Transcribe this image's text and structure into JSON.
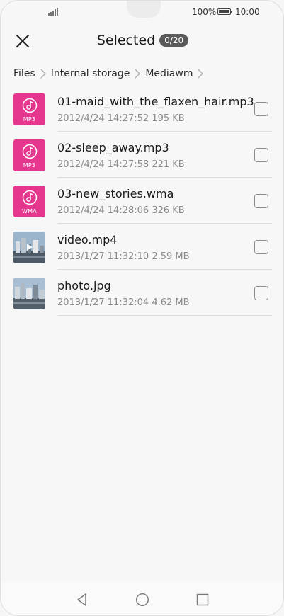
{
  "status_bar": {
    "battery_percent": "100%",
    "time": "10:00"
  },
  "header": {
    "title": "Selected",
    "count_badge": "0/20",
    "close_icon": "close-icon"
  },
  "breadcrumb": [
    "Files",
    "Internal storage",
    "Mediawm"
  ],
  "files": [
    {
      "name": "01-maid_with_the_flaxen_hair.mp3",
      "date": "2012/4/24 14:27:52",
      "size": "195 KB",
      "type": "music",
      "badge": "MP3",
      "checked": false
    },
    {
      "name": "02-sleep_away.mp3",
      "date": "2012/4/24 14:27:58",
      "size": "221 KB",
      "type": "music",
      "badge": "MP3",
      "checked": false
    },
    {
      "name": "03-new_stories.wma",
      "date": "2012/4/24 14:28:06",
      "size": "326 KB",
      "type": "music",
      "badge": "WMA",
      "checked": false
    },
    {
      "name": "video.mp4",
      "date": "2013/1/27 11:32:10",
      "size": "2.59 MB",
      "type": "video",
      "checked": false
    },
    {
      "name": "photo.jpg",
      "date": "2013/1/27 11:32:04",
      "size": "4.62 MB",
      "type": "photo",
      "checked": false
    }
  ],
  "nav_bar": {
    "back_icon": "back-icon",
    "home_icon": "home-icon",
    "recents_icon": "recents-icon"
  },
  "colors": {
    "music_accent": "#e6378f",
    "badge_bg": "#5a5a5a"
  }
}
